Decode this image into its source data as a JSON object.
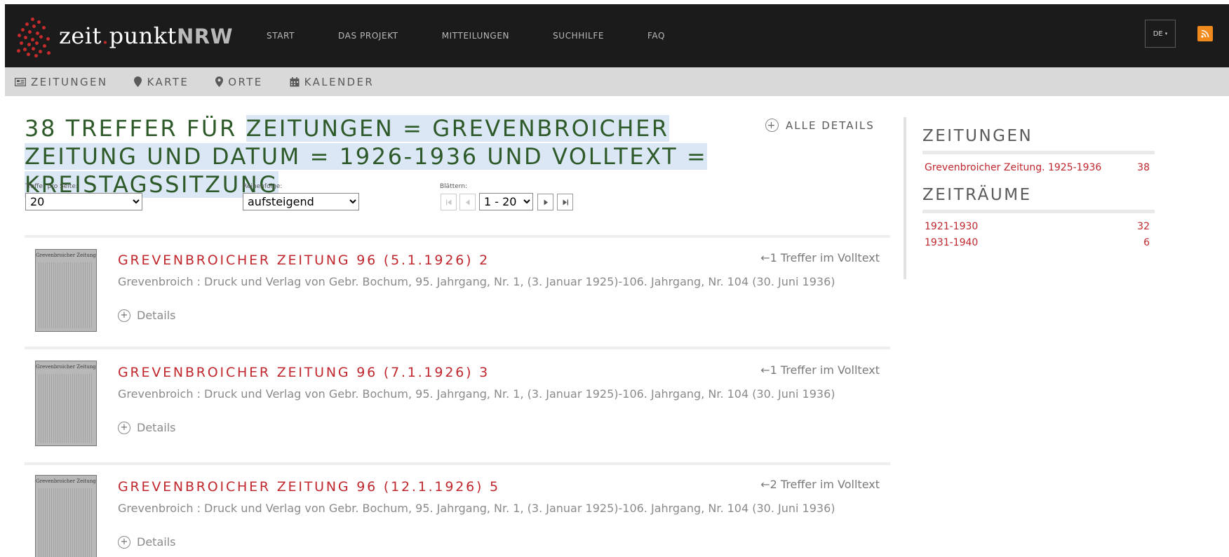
{
  "header": {
    "logo": {
      "part1": "zeit",
      "dot": ".",
      "part2": "punkt",
      "part3": "NRW"
    },
    "nav": [
      "START",
      "DAS PROJEKT",
      "MITTEILUNGEN",
      "SUCHHILFE",
      "FAQ"
    ],
    "language": "DE",
    "rss_icon": "rss-icon",
    "colors": {
      "background": "#1b1b1b",
      "accent": "#c62b2b",
      "rss": "#f08a1c"
    }
  },
  "subnav": [
    {
      "label": "ZEITUNGEN",
      "icon": "newspaper-icon"
    },
    {
      "label": "KARTE",
      "icon": "map-marker-icon"
    },
    {
      "label": "ORTE",
      "icon": "location-icon"
    },
    {
      "label": "KALENDER",
      "icon": "calendar-icon"
    }
  ],
  "search": {
    "heading_prefix": "38 TREFFER FÜR ",
    "heading_query": "ZEITUNGEN = GREVENBROICHER ZEITUNG UND DATUM = 1926-1936 UND VOLLTEXT = KREISTAGSSITZUNG",
    "all_details": "ALLE DETAILS",
    "per_page_label": "Treffer pro Seite:",
    "per_page_value": "20",
    "order_label": "Reihenfolge:",
    "order_value": "aufsteigend",
    "paging_label": "Blättern:",
    "paging_value": "1 - 20"
  },
  "results": [
    {
      "title": "GREVENBROICHER ZEITUNG 96 (5.1.1926) 2",
      "hits": "←1 Treffer im Volltext",
      "description": "Grevenbroich : Druck und Verlag von Gebr. Bochum, 95. Jahrgang, Nr. 1, (3. Januar 1925)-106. Jahrgang, Nr. 104 (30. Juni 1936)",
      "details": "Details",
      "thumb_masthead": "Grevenbroicher Zeitung"
    },
    {
      "title": "GREVENBROICHER ZEITUNG 96 (7.1.1926) 3",
      "hits": "←1 Treffer im Volltext",
      "description": "Grevenbroich : Druck und Verlag von Gebr. Bochum, 95. Jahrgang, Nr. 1, (3. Januar 1925)-106. Jahrgang, Nr. 104 (30. Juni 1936)",
      "details": "Details",
      "thumb_masthead": "Grevenbroicher Zeitung"
    },
    {
      "title": "GREVENBROICHER ZEITUNG 96 (12.1.1926) 5",
      "hits": "←2 Treffer im Volltext",
      "description": "Grevenbroich : Druck und Verlag von Gebr. Bochum, 95. Jahrgang, Nr. 1, (3. Januar 1925)-106. Jahrgang, Nr. 104 (30. Juni 1936)",
      "details": "Details",
      "thumb_masthead": "Grevenbroicher Zeitung"
    }
  ],
  "facets": {
    "newspapers": {
      "title": "ZEITUNGEN",
      "items": [
        {
          "label": "Grevenbroicher Zeitung. 1925-1936",
          "count": "38"
        }
      ]
    },
    "periods": {
      "title": "ZEITRÄUME",
      "items": [
        {
          "label": "1921-1930",
          "count": "32"
        },
        {
          "label": "1931-1940",
          "count": "6"
        }
      ]
    }
  }
}
